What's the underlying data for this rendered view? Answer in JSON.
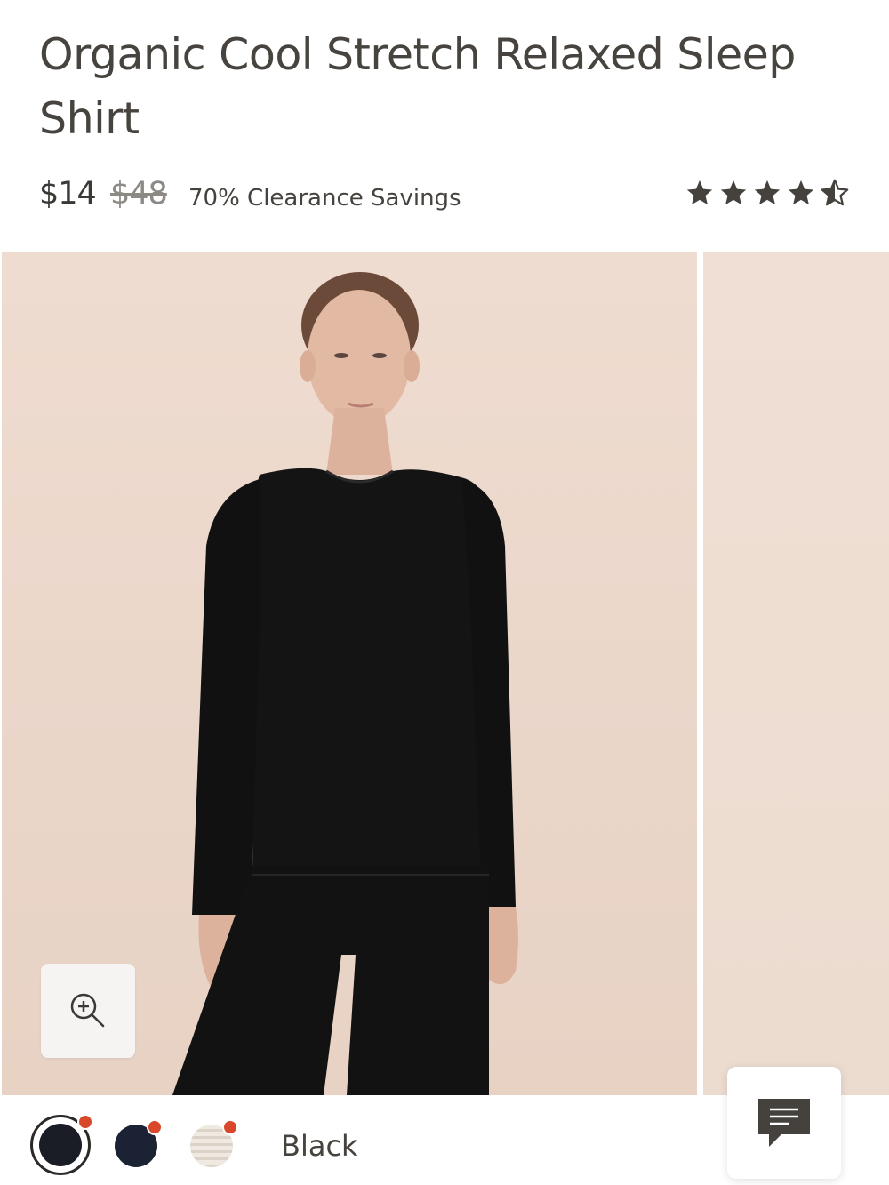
{
  "product": {
    "title": "Organic Cool Stretch Relaxed Sleep Shirt",
    "price_current": "$14",
    "price_original": "$48",
    "savings": "70% Clearance Savings",
    "rating": 4.5,
    "rating_max": 5
  },
  "gallery": {
    "zoom_icon": "zoom-in-icon"
  },
  "colors": {
    "options": [
      {
        "name": "black",
        "swatch": "#1a1c26",
        "selected": true
      },
      {
        "name": "navy",
        "swatch": "#1b2233",
        "selected": false
      },
      {
        "name": "stripe",
        "swatch": "#efe9e2",
        "selected": false
      }
    ],
    "selected_label": "Black",
    "badge_color": "#d9482b"
  },
  "chat": {
    "icon": "chat-icon"
  }
}
